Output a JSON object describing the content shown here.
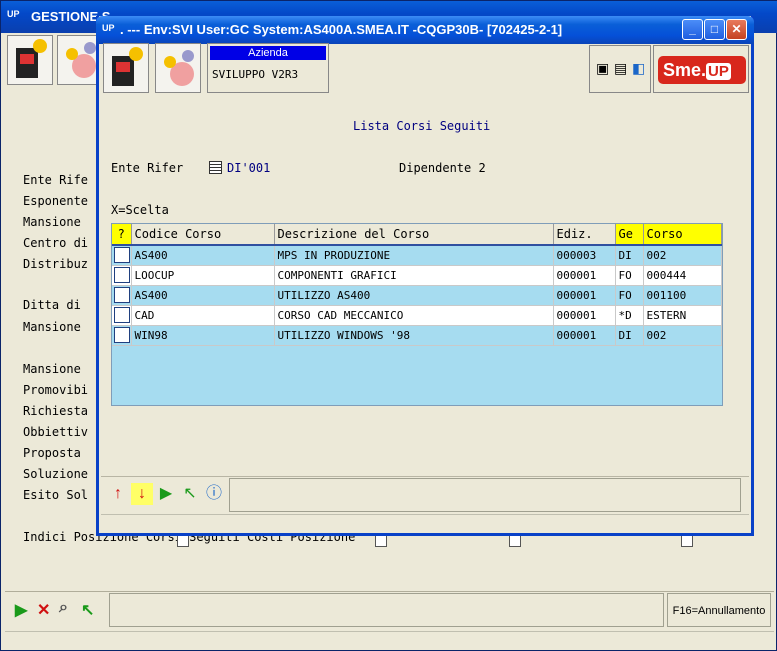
{
  "background_window": {
    "title": "GESTIONE S",
    "up_label": "UP",
    "labels": [
      "Ente Rife",
      "Esponente",
      "Mansione",
      "Centro di",
      "Distribuz",
      "Ditta di",
      "Mansione",
      "Mansione",
      "Promovibi",
      "Richiesta",
      "Obbiettiv",
      "Proposta",
      "Soluzione",
      "Esito Sol"
    ],
    "bottom_row": "Indici Posizione     Corsi Seguiti        Costi          Posizione",
    "f16": "F16=Annullamento"
  },
  "dialog": {
    "up_label": "UP",
    "title": ". --- Env:SVI User:GC System:AS400A.SMEA.IT -CQGP30B- [702425-2-1]",
    "azienda_label": "Azienda",
    "azienda_value": "SVILUPPO V2R3",
    "smeup_logo": "Sme.",
    "smeup_logo_up": "UP",
    "heading": "Lista Corsi Seguiti",
    "ente_label": "Ente Rifer",
    "ente_value": "DI'001",
    "dipendente": "Dipendente 2",
    "x_scelta": "X=Scelta",
    "columns": [
      "?",
      "Codice Corso",
      "Descrizione del Corso",
      "Ediz.",
      "Ge",
      "Corso"
    ],
    "rows": [
      {
        "codice": "AS400",
        "descrizione": "MPS IN PRODUZIONE",
        "ediz": "000003",
        "ge": "DI",
        "corso": "002"
      },
      {
        "codice": "LOOCUP",
        "descrizione": "COMPONENTI GRAFICI",
        "ediz": "000001",
        "ge": "FO",
        "corso": "000444"
      },
      {
        "codice": "AS400",
        "descrizione": "UTILIZZO AS400",
        "ediz": "000001",
        "ge": "FO",
        "corso": "001100"
      },
      {
        "codice": "CAD",
        "descrizione": "CORSO CAD MECCANICO",
        "ediz": "000001",
        "ge": "*D",
        "corso": "ESTERN"
      },
      {
        "codice": "WIN98",
        "descrizione": "UTILIZZO WINDOWS '98",
        "ediz": "000001",
        "ge": "DI",
        "corso": "002"
      }
    ]
  },
  "colors": {
    "title_blue": "#0a5fd8",
    "grid_cyan": "#a6dcf0",
    "header_yellow": "#ffff00",
    "heading_navy": "#000080"
  }
}
